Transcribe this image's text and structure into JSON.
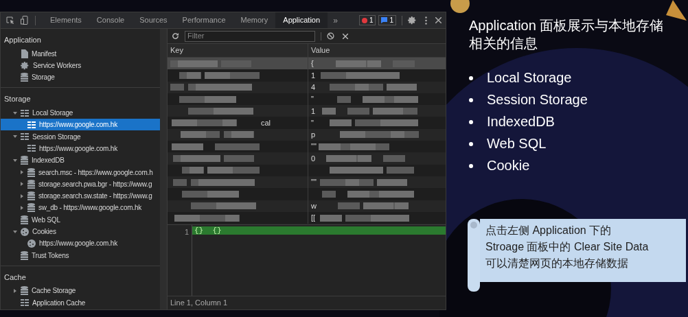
{
  "devtools": {
    "tabs": [
      {
        "label": "Elements",
        "selected": false
      },
      {
        "label": "Console",
        "selected": false
      },
      {
        "label": "Sources",
        "selected": false
      },
      {
        "label": "Performance",
        "selected": false
      },
      {
        "label": "Memory",
        "selected": false
      },
      {
        "label": "Application",
        "selected": true
      }
    ],
    "more": "»",
    "errors": "1",
    "messages": "1",
    "sidebar": [
      {
        "title": "Application",
        "items": [
          {
            "kind": "file",
            "label": "Manifest"
          },
          {
            "kind": "gear",
            "label": "Service Workers"
          },
          {
            "kind": "database",
            "label": "Storage"
          }
        ]
      },
      {
        "title": "Storage",
        "items": [
          {
            "kind": "table",
            "label": "Local Storage",
            "expanded": true,
            "selected": false,
            "children": [
              {
                "kind": "table",
                "label": "https://www.google.com.hk",
                "selected": true
              }
            ]
          },
          {
            "kind": "table",
            "label": "Session Storage",
            "expanded": true,
            "selected": false,
            "children": [
              {
                "kind": "table",
                "label": "https://www.google.com.hk",
                "selected": false
              }
            ]
          },
          {
            "kind": "database",
            "label": "IndexedDB",
            "expanded": true,
            "selected": false,
            "children": [
              {
                "kind": "database",
                "label": "search.msc - https://www.google.com.h",
                "expanded": false,
                "selected": false
              },
              {
                "kind": "database",
                "label": "storage.search.pwa.bgr - https://www.g",
                "expanded": false,
                "selected": false
              },
              {
                "kind": "database",
                "label": "storage.search.sw.state - https://www.g",
                "expanded": false,
                "selected": false
              },
              {
                "kind": "database",
                "label": "sw_db - https://www.google.com.hk",
                "expanded": false,
                "selected": false
              }
            ]
          },
          {
            "kind": "database",
            "label": "Web SQL",
            "selected": false
          },
          {
            "kind": "cookie",
            "label": "Cookies",
            "expanded": true,
            "selected": false,
            "children": [
              {
                "kind": "cookie",
                "label": "https://www.google.com.hk",
                "selected": false
              }
            ]
          },
          {
            "kind": "database",
            "label": "Trust Tokens",
            "selected": false
          }
        ]
      },
      {
        "title": "Cache",
        "items": [
          {
            "kind": "database",
            "label": "Cache Storage",
            "expanded": false,
            "selected": false
          },
          {
            "kind": "table",
            "label": "Application Cache",
            "selected": false
          }
        ]
      }
    ],
    "filter": {
      "placeholder": "Filter"
    },
    "table": {
      "columns": [
        "Key",
        "Value"
      ],
      "rows": [
        {
          "key": "",
          "value": "{",
          "selected": true
        },
        {
          "key": "",
          "value": "1",
          "selected": false
        },
        {
          "key": "",
          "value": "4",
          "selected": false
        },
        {
          "key": "",
          "value": "\"",
          "selected": false
        },
        {
          "key": "",
          "value": "1",
          "selected": false
        },
        {
          "key": "cal",
          "value": "\"",
          "selected": false
        },
        {
          "key": "",
          "value": "p",
          "selected": false
        },
        {
          "key": "",
          "value": "\"\"",
          "selected": false
        },
        {
          "key": "",
          "value": "0",
          "selected": false
        },
        {
          "key": "",
          "value": "",
          "selected": false
        },
        {
          "key": "",
          "value": "\"\"",
          "selected": false
        },
        {
          "key": "",
          "value": "",
          "selected": false
        },
        {
          "key": "",
          "value": "w",
          "selected": false
        },
        {
          "key": "",
          "value": "[[",
          "selected": false
        }
      ]
    },
    "editor": {
      "line_number": "1",
      "code": "{}  {}"
    },
    "status": "Line 1, Column 1"
  },
  "slide": {
    "title": "Application 面板展示与本地存储相关的信息",
    "bullets": [
      "Local Storage",
      "Session Storage",
      "IndexedDB",
      "Web SQL",
      "Cookie"
    ],
    "note": [
      "点击左侧 Application 下的",
      "Stroage 面板中的 Clear Site Data",
      "可以清楚网页的本地存储数据"
    ]
  }
}
